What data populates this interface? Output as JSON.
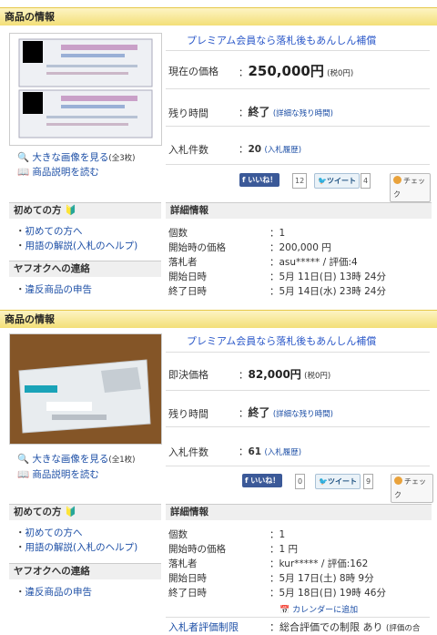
{
  "listing1": {
    "section_title": "商品の情報",
    "premium_banner": "プレミアム会員なら落札後もあんしん補償",
    "view_large": "大きな画像を見る",
    "view_large_count": "(全3枚)",
    "read_desc": "商品説明を読む",
    "price_label": "現在の価格",
    "price_value": "250,000円",
    "price_tax": "(税0円)",
    "time_label": "残り時間",
    "time_value": "終了",
    "time_detail": "(詳細な残り時間)",
    "bids_label": "入札件数",
    "bids_value": "20",
    "bids_history": "(入札履歴)",
    "like_label": "いいね！",
    "like_count": "12",
    "tweet_label": "ツイート",
    "tweet_count": "4",
    "check_label": "チェック",
    "beginner_title": "初めての方",
    "beginner_link1": "初めての方へ",
    "beginner_link2": "用語の解説(入札のヘルプ)",
    "contact_title": "ヤフオクへの連絡",
    "contact_link": "違反商品の申告",
    "detail_title": "詳細情報",
    "details": [
      {
        "label": "個数",
        "value": "1"
      },
      {
        "label": "開始時の価格",
        "value": "200,000 円"
      },
      {
        "label": "落札者",
        "value": "asu***** / 評価:4"
      },
      {
        "label": "開始日時",
        "value": "5月 11日(日) 13時 24分"
      },
      {
        "label": "終了日時",
        "value": "5月 14日(水) 23時 24分"
      }
    ]
  },
  "listing2": {
    "section_title": "商品の情報",
    "premium_banner": "プレミアム会員なら落札後もあんしん補償",
    "view_large": "大きな画像を見る",
    "view_large_count": "(全1枚)",
    "read_desc": "商品説明を読む",
    "price_label": "即決価格",
    "price_value": "82,000円",
    "price_tax": "(税0円)",
    "time_label": "残り時間",
    "time_value": "終了",
    "time_detail": "(詳細な残り時間)",
    "bids_label": "入札件数",
    "bids_value": "61",
    "bids_history": "(入札履歴)",
    "like_label": "いいね！",
    "like_count": "0",
    "tweet_label": "ツイート",
    "tweet_count": "9",
    "check_label": "チェック",
    "beginner_title": "初めての方",
    "beginner_link1": "初めての方へ",
    "beginner_link2": "用語の解説(入札のヘルプ)",
    "contact_title": "ヤフオクへの連絡",
    "contact_link": "違反商品の申告",
    "detail_title": "詳細情報",
    "details": [
      {
        "label": "個数",
        "value": "1"
      },
      {
        "label": "開始時の価格",
        "value": "1 円"
      },
      {
        "label": "落札者",
        "value": "kur***** / 評価:162"
      },
      {
        "label": "開始日時",
        "value": "5月 17日(土) 8時 9分"
      },
      {
        "label": "終了日時",
        "value": "5月 18日(日) 19時 46分"
      }
    ],
    "calendar_link": "カレンダーに追加",
    "restriction_label": "入札者評価制限",
    "restriction_value": "総合評価での制限 あり",
    "restriction_note": "(評価の合"
  },
  "colors": {
    "header_bg": "#f3df78",
    "link": "#1d4fa6",
    "banner": "#2b58c9"
  }
}
